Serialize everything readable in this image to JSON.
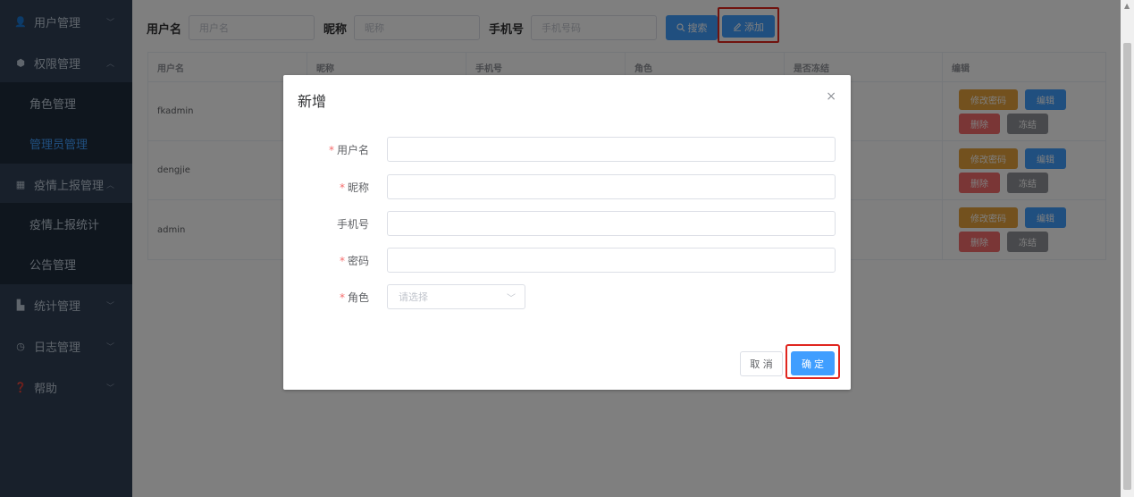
{
  "sidebar": {
    "items": [
      {
        "label": "用户管理",
        "icon": "user-icon",
        "glyph": "👤",
        "arrow": "﹀"
      },
      {
        "label": "权限管理",
        "icon": "location-pin-icon",
        "glyph": "⬢",
        "arrow": "︿"
      },
      {
        "label": "角色管理"
      },
      {
        "label": "管理员管理"
      },
      {
        "label": "疫情上报管理",
        "icon": "grid-icon",
        "glyph": "▦",
        "arrow": "︿"
      },
      {
        "label": "疫情上报统计"
      },
      {
        "label": "公告管理"
      },
      {
        "label": "统计管理",
        "icon": "chart-icon",
        "glyph": "▙",
        "arrow": "﹀"
      },
      {
        "label": "日志管理",
        "icon": "clock-icon",
        "glyph": "◷",
        "arrow": "﹀"
      },
      {
        "label": "帮助",
        "icon": "help-icon",
        "glyph": "❓",
        "arrow": "﹀"
      }
    ]
  },
  "search": {
    "username_label": "用户名",
    "username_placeholder": "用户名",
    "nickname_label": "昵称",
    "nickname_placeholder": "昵称",
    "phone_label": "手机号",
    "phone_placeholder": "手机号码",
    "search_btn": "搜索",
    "search_icon": "search-icon",
    "add_btn": "添加",
    "add_icon": "edit-icon"
  },
  "table": {
    "headers": [
      "用户名",
      "昵称",
      "手机号",
      "角色",
      "是否冻结",
      "编辑"
    ],
    "rows": [
      {
        "username": "fkadmin"
      },
      {
        "username": "dengjie"
      },
      {
        "username": "admin"
      }
    ],
    "ops": {
      "change_password": "修改密码",
      "edit": "编辑",
      "delete": "删除",
      "freeze": "冻结"
    }
  },
  "dialog": {
    "title": "新增",
    "close": "×",
    "fields": [
      {
        "label": "用户名",
        "required": "*"
      },
      {
        "label": "昵称",
        "required": "*"
      },
      {
        "label": "手机号",
        "required": ""
      },
      {
        "label": "密码",
        "required": "*"
      },
      {
        "label": "角色",
        "required": "*"
      }
    ],
    "role_placeholder": "请选择",
    "cancel": "取 消",
    "confirm": "确 定"
  },
  "colors": {
    "sidebar_bg": "#304156",
    "primary": "#409eff",
    "warning": "#e6a23c",
    "danger": "#f56c6c",
    "info": "#909399",
    "highlight_border": "#e0261f"
  }
}
